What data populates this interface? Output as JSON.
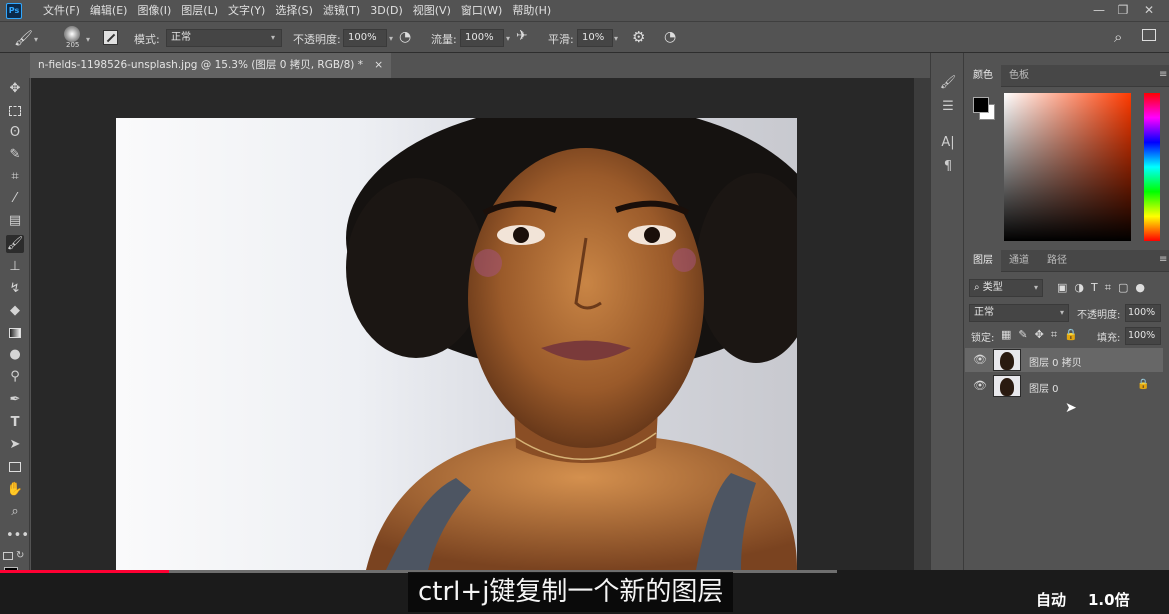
{
  "app": {
    "logo": "Ps"
  },
  "menu": [
    "文件(F)",
    "编辑(E)",
    "图像(I)",
    "图层(L)",
    "文字(Y)",
    "选择(S)",
    "滤镜(T)",
    "3D(D)",
    "视图(V)",
    "窗口(W)",
    "帮助(H)"
  ],
  "options": {
    "brush_size": "205",
    "mode_label": "模式:",
    "mode_value": "正常",
    "opacity_label": "不透明度:",
    "opacity_value": "100%",
    "flow_label": "流量:",
    "flow_value": "100%",
    "smooth_label": "平滑:",
    "smooth_value": "10%"
  },
  "document": {
    "tab_title": "n-fields-1198526-unsplash.jpg @ 15.3% (图层 0 拷贝, RGB/8) *",
    "close": "×"
  },
  "color_panel": {
    "tabs": [
      "颜色",
      "色板"
    ],
    "foreground": "#000000",
    "background": "#ffffff"
  },
  "layers_panel": {
    "tabs": [
      "图层",
      "通道",
      "路径"
    ],
    "filter_label": "类型",
    "blend_mode": "正常",
    "opacity_label": "不透明度:",
    "opacity_value": "100%",
    "lock_label": "锁定:",
    "fill_label": "填充:",
    "fill_value": "100%",
    "layers": [
      {
        "name": "图层 0 拷贝",
        "selected": true,
        "locked": false
      },
      {
        "name": "图层 0",
        "selected": false,
        "locked": true
      }
    ]
  },
  "video": {
    "subtitle": "ctrl+j键复制一个新的图层",
    "quality": "自动",
    "speed": "1.0倍",
    "progress": 0.17,
    "buffered": 0.716
  },
  "colors": {
    "accent": "#31a8ff",
    "progress": "#ff0033"
  }
}
